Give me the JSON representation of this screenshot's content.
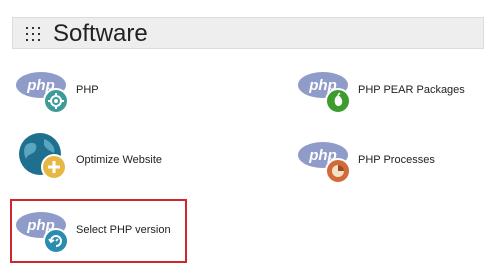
{
  "header": {
    "title": "Software"
  },
  "items": [
    {
      "label": "PHP",
      "icon": "php-settings-icon",
      "badge_color": "#3f9a9a"
    },
    {
      "label": "PHP PEAR Packages",
      "icon": "php-pear-icon",
      "badge_color": "#3e9b2e"
    },
    {
      "label": "Optimize Website",
      "icon": "optimize-website-icon",
      "badge_color": "#1f6f8e"
    },
    {
      "label": "PHP Processes",
      "icon": "php-processes-icon",
      "badge_color": "#d26a3a"
    },
    {
      "label": "Select PHP version",
      "icon": "php-version-icon",
      "badge_color": "#2a8db0"
    }
  ],
  "colors": {
    "php_logo": "#8f9bc9",
    "highlight_border": "#d0262d"
  }
}
